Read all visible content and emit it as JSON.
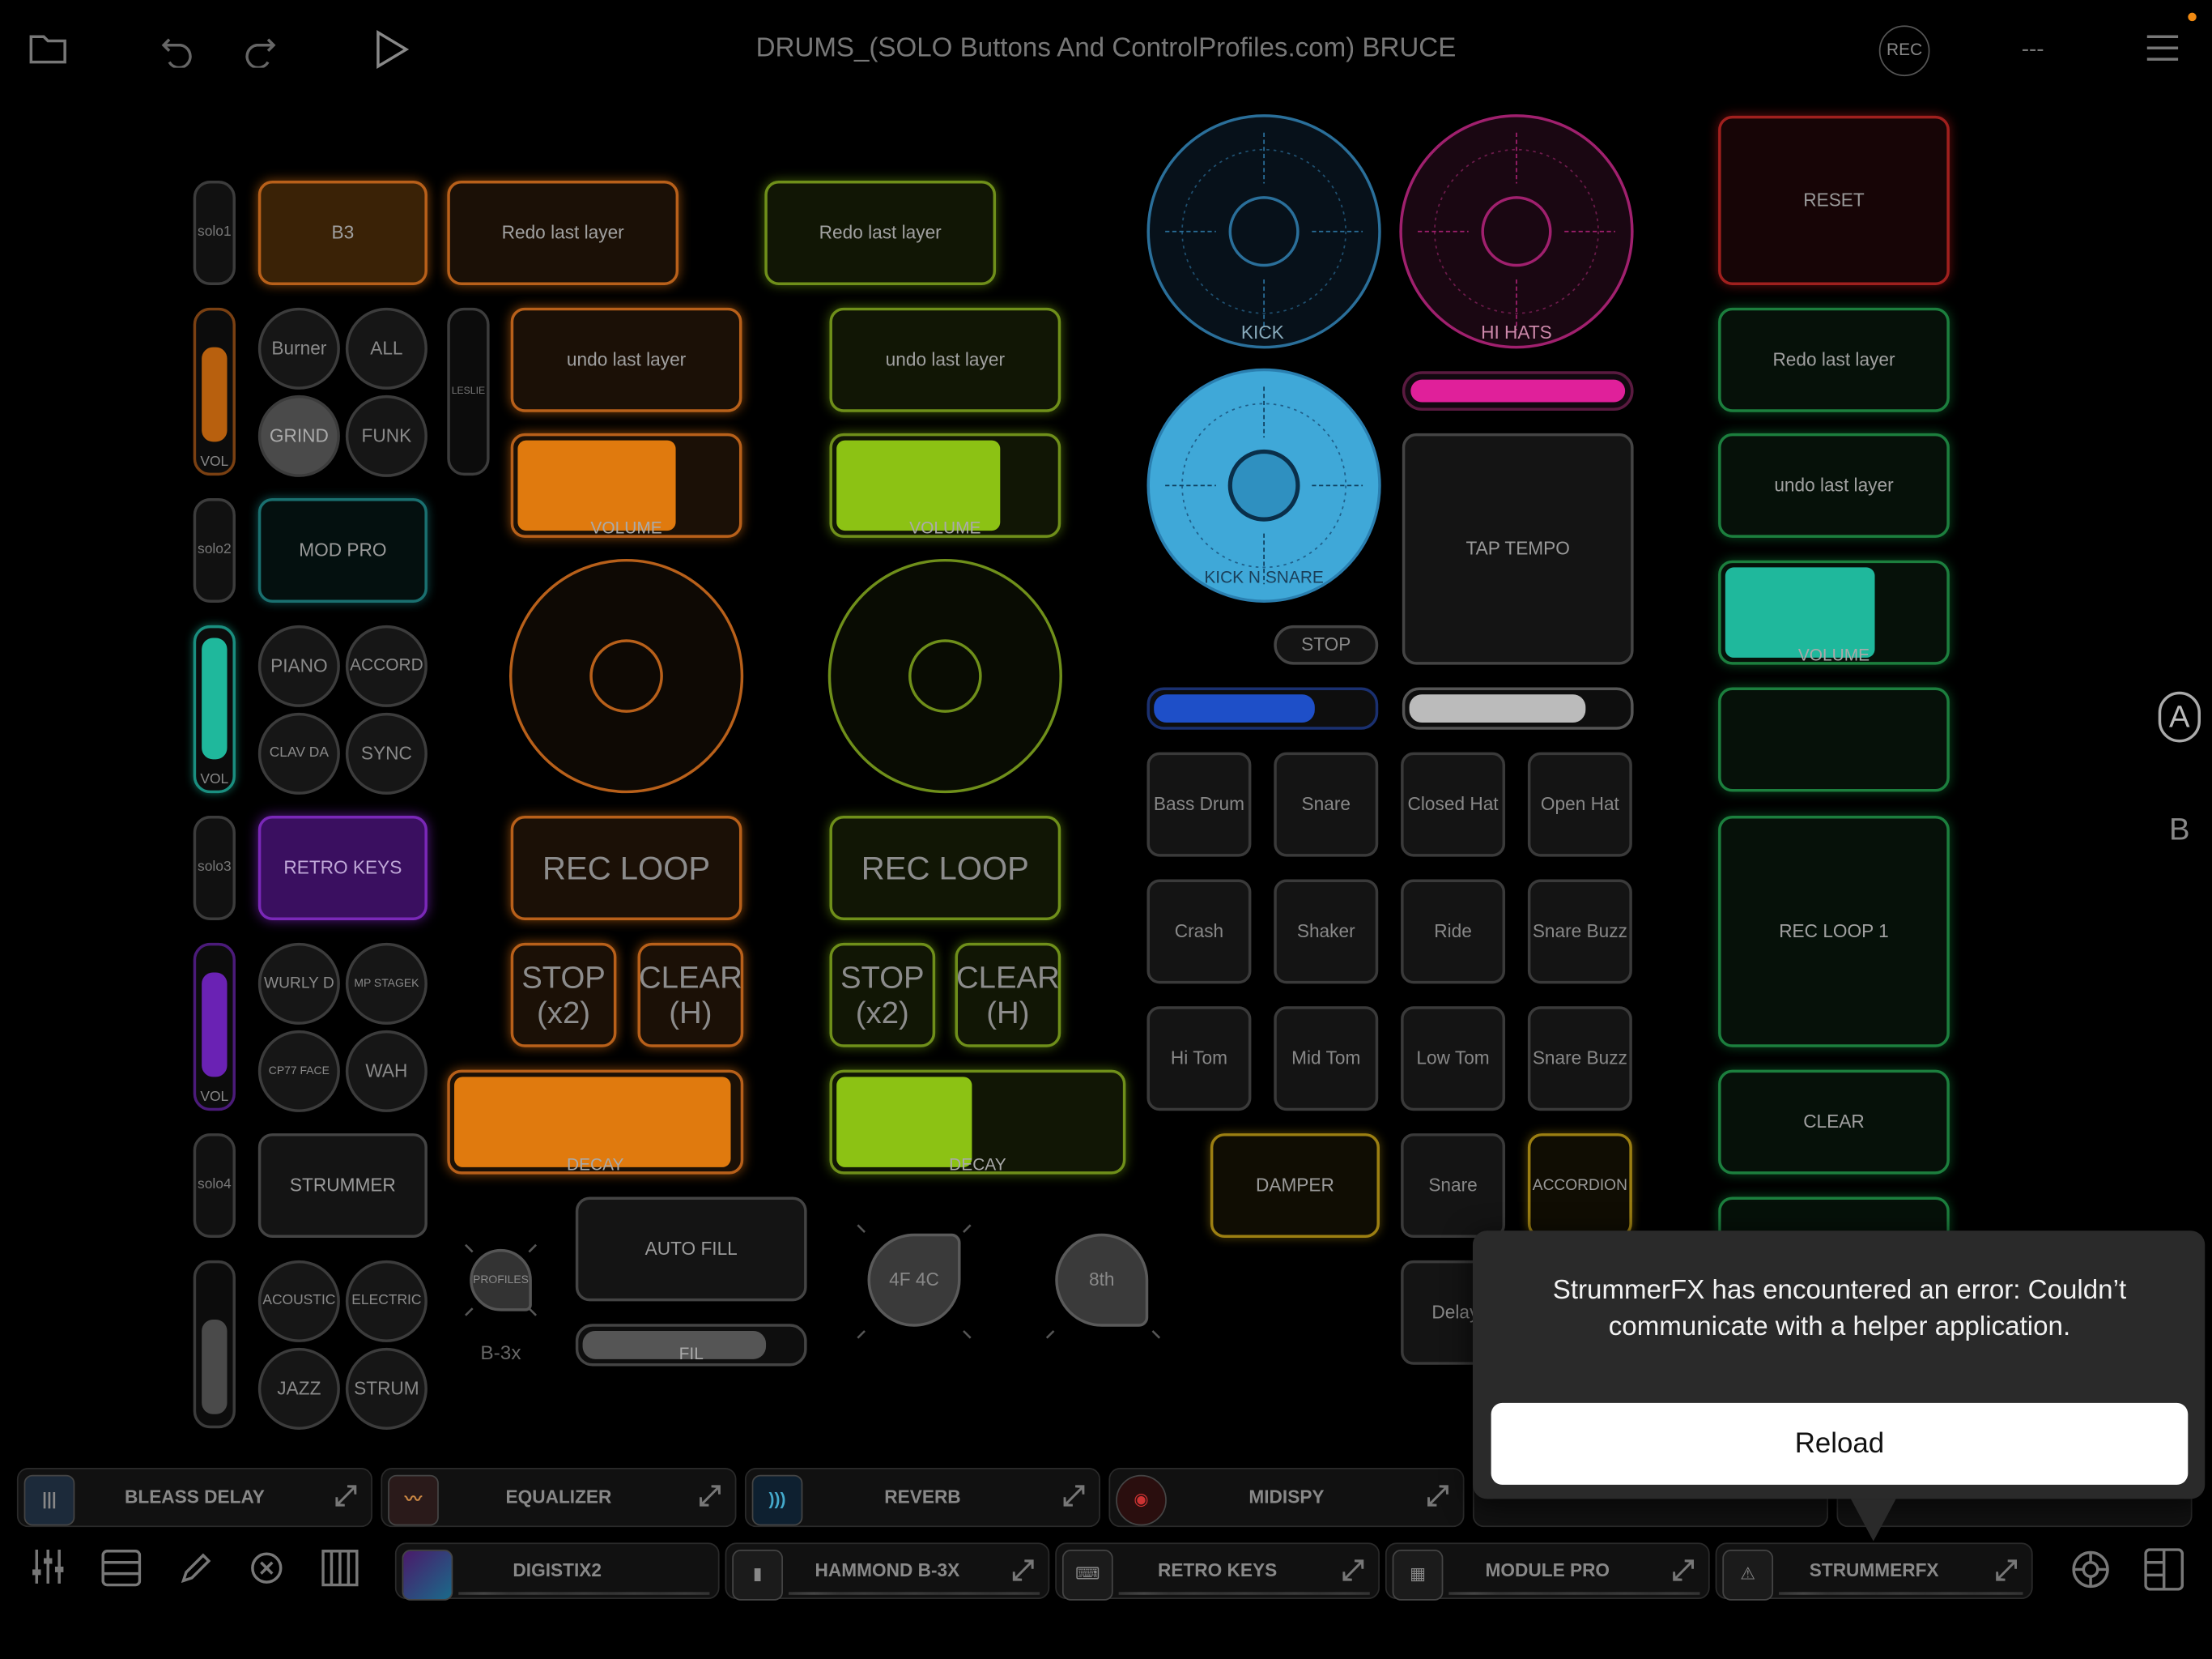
{
  "header": {
    "title": "DRUMS_(SOLO Buttons And ControlProfiles.com) BRUCE",
    "rec_label": "REC",
    "dash_label": "---"
  },
  "left_strip": {
    "solo": [
      "solo1",
      "solo2",
      "solo3",
      "solo4"
    ],
    "vol_label": "VOL",
    "slider_fill": [
      0.55,
      0.9,
      0.75,
      0.55
    ],
    "leslie_label": "LESLIE"
  },
  "instruments": {
    "b3": "B3",
    "burner": "Burner",
    "all": "ALL",
    "grind": "GRIND",
    "funk": "FUNK",
    "mod_pro": "MOD PRO",
    "piano": "PIANO",
    "accord": "ACCORD",
    "clav_da": "CLAV DA",
    "sync": "SYNC",
    "retro_keys": "RETRO KEYS",
    "wurly_d": "WURLY D",
    "mp_stagek": "MP STAGEK",
    "cp77_face": "CP77 FACE",
    "wah": "WAH",
    "strummer": "STRUMMER",
    "acoustic": "ACOUSTIC",
    "electric": "ELECTRIC",
    "jazz": "JAZZ",
    "strum": "STRUM",
    "profiles": "PROFILES",
    "b3x": "B-3x"
  },
  "looper1": {
    "redo": "Redo last layer",
    "undo": "undo last layer",
    "volume": "VOLUME",
    "volume_value": 0.7,
    "rec_loop": "REC LOOP",
    "stop": "STOP\n(x2)",
    "clear": "CLEAR\n(H)",
    "decay": "DECAY",
    "decay_value": 0.97
  },
  "looper2": {
    "redo": "Redo  last layer",
    "undo": "undo last layer",
    "volume": "VOLUME",
    "volume_value": 0.72,
    "rec_loop": "REC LOOP",
    "stop": "STOP\n(x2)",
    "clear": "CLEAR\n(H)",
    "decay": "DECAY",
    "decay_value": 0.47
  },
  "fill": {
    "auto_fill": "AUTO FILL",
    "fil": "FIL",
    "fil_value": 0.82,
    "knob_4f4c": "4F 4C",
    "knob_8th": "8th"
  },
  "drums": {
    "kick": "KICK",
    "hi_hats": "HI HATS",
    "kick_n_snare": "KICK N SNARE",
    "stop": "STOP",
    "tap_tempo": "TAP TEMPO",
    "blue_slider_value": 0.73,
    "white_slider_value": 0.8,
    "pads": [
      "Bass Drum",
      "Snare",
      "Closed Hat",
      "Open Hat",
      "Crash",
      "Shaker",
      "Ride",
      "Snare Buzz",
      "Hi Tom",
      "Mid Tom",
      "Low Tom",
      "Snare Buzz"
    ],
    "damper": "DAMPER",
    "snare": "Snare",
    "accordion": "ACCORDION",
    "delay": "Delay"
  },
  "right_col": {
    "reset": "RESET",
    "redo": "Redo last layer",
    "undo": "undo last layer",
    "volume": "VOLUME",
    "volume_value": 0.7,
    "rec_loop_1": "REC LOOP 1",
    "clear": "CLEAR"
  },
  "side_labels": {
    "a": "A",
    "b": "B"
  },
  "plugins_row1": [
    "BLEASS DELAY",
    "EQUALIZER",
    "REVERB",
    "MIDISPY"
  ],
  "plugins_row2": [
    "DIGISTIX2",
    "HAMMOND B-3X",
    "RETRO KEYS",
    "MODULE PRO",
    "STRUMMERFX"
  ],
  "dialog": {
    "message": "StrummerFX has encountered an error: Couldn’t communicate with a helper application.",
    "reload": "Reload"
  },
  "colors": {
    "orange": "#f08a12",
    "lime": "#9ad417",
    "teal": "#1fc8a8",
    "purple": "#8a2fd6",
    "blue": "#1e4fc8",
    "magenta": "#e0209a",
    "red": "#c02020",
    "cyan": "#3aa8e0"
  }
}
